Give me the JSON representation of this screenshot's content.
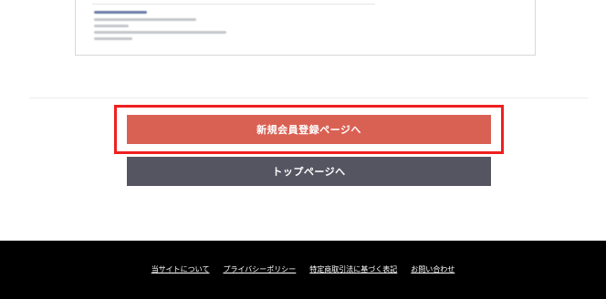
{
  "buttons": {
    "register_label": "新規会員登録ページへ",
    "top_label": "トップページへ"
  },
  "footer": {
    "links": [
      "当サイトについて",
      "プライバシーポリシー",
      "特定商取引法に基づく表記",
      "お問い合わせ"
    ]
  },
  "colors": {
    "register_button": "#d96153",
    "top_button": "#555562",
    "highlight_border": "#ef1f1f",
    "footer_background": "#000000"
  }
}
